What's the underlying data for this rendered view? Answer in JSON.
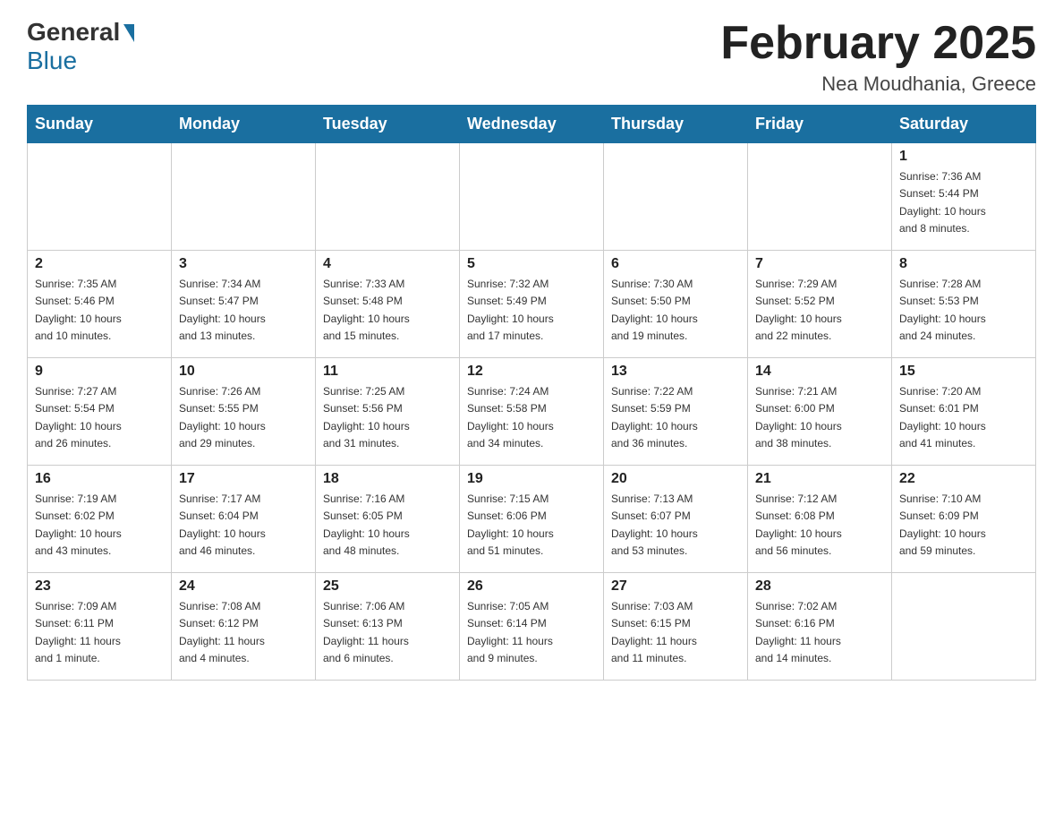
{
  "header": {
    "logo_general": "General",
    "logo_blue": "Blue",
    "month_title": "February 2025",
    "location": "Nea Moudhania, Greece"
  },
  "weekdays": [
    "Sunday",
    "Monday",
    "Tuesday",
    "Wednesday",
    "Thursday",
    "Friday",
    "Saturday"
  ],
  "weeks": [
    [
      {
        "day": "",
        "info": ""
      },
      {
        "day": "",
        "info": ""
      },
      {
        "day": "",
        "info": ""
      },
      {
        "day": "",
        "info": ""
      },
      {
        "day": "",
        "info": ""
      },
      {
        "day": "",
        "info": ""
      },
      {
        "day": "1",
        "info": "Sunrise: 7:36 AM\nSunset: 5:44 PM\nDaylight: 10 hours\nand 8 minutes."
      }
    ],
    [
      {
        "day": "2",
        "info": "Sunrise: 7:35 AM\nSunset: 5:46 PM\nDaylight: 10 hours\nand 10 minutes."
      },
      {
        "day": "3",
        "info": "Sunrise: 7:34 AM\nSunset: 5:47 PM\nDaylight: 10 hours\nand 13 minutes."
      },
      {
        "day": "4",
        "info": "Sunrise: 7:33 AM\nSunset: 5:48 PM\nDaylight: 10 hours\nand 15 minutes."
      },
      {
        "day": "5",
        "info": "Sunrise: 7:32 AM\nSunset: 5:49 PM\nDaylight: 10 hours\nand 17 minutes."
      },
      {
        "day": "6",
        "info": "Sunrise: 7:30 AM\nSunset: 5:50 PM\nDaylight: 10 hours\nand 19 minutes."
      },
      {
        "day": "7",
        "info": "Sunrise: 7:29 AM\nSunset: 5:52 PM\nDaylight: 10 hours\nand 22 minutes."
      },
      {
        "day": "8",
        "info": "Sunrise: 7:28 AM\nSunset: 5:53 PM\nDaylight: 10 hours\nand 24 minutes."
      }
    ],
    [
      {
        "day": "9",
        "info": "Sunrise: 7:27 AM\nSunset: 5:54 PM\nDaylight: 10 hours\nand 26 minutes."
      },
      {
        "day": "10",
        "info": "Sunrise: 7:26 AM\nSunset: 5:55 PM\nDaylight: 10 hours\nand 29 minutes."
      },
      {
        "day": "11",
        "info": "Sunrise: 7:25 AM\nSunset: 5:56 PM\nDaylight: 10 hours\nand 31 minutes."
      },
      {
        "day": "12",
        "info": "Sunrise: 7:24 AM\nSunset: 5:58 PM\nDaylight: 10 hours\nand 34 minutes."
      },
      {
        "day": "13",
        "info": "Sunrise: 7:22 AM\nSunset: 5:59 PM\nDaylight: 10 hours\nand 36 minutes."
      },
      {
        "day": "14",
        "info": "Sunrise: 7:21 AM\nSunset: 6:00 PM\nDaylight: 10 hours\nand 38 minutes."
      },
      {
        "day": "15",
        "info": "Sunrise: 7:20 AM\nSunset: 6:01 PM\nDaylight: 10 hours\nand 41 minutes."
      }
    ],
    [
      {
        "day": "16",
        "info": "Sunrise: 7:19 AM\nSunset: 6:02 PM\nDaylight: 10 hours\nand 43 minutes."
      },
      {
        "day": "17",
        "info": "Sunrise: 7:17 AM\nSunset: 6:04 PM\nDaylight: 10 hours\nand 46 minutes."
      },
      {
        "day": "18",
        "info": "Sunrise: 7:16 AM\nSunset: 6:05 PM\nDaylight: 10 hours\nand 48 minutes."
      },
      {
        "day": "19",
        "info": "Sunrise: 7:15 AM\nSunset: 6:06 PM\nDaylight: 10 hours\nand 51 minutes."
      },
      {
        "day": "20",
        "info": "Sunrise: 7:13 AM\nSunset: 6:07 PM\nDaylight: 10 hours\nand 53 minutes."
      },
      {
        "day": "21",
        "info": "Sunrise: 7:12 AM\nSunset: 6:08 PM\nDaylight: 10 hours\nand 56 minutes."
      },
      {
        "day": "22",
        "info": "Sunrise: 7:10 AM\nSunset: 6:09 PM\nDaylight: 10 hours\nand 59 minutes."
      }
    ],
    [
      {
        "day": "23",
        "info": "Sunrise: 7:09 AM\nSunset: 6:11 PM\nDaylight: 11 hours\nand 1 minute."
      },
      {
        "day": "24",
        "info": "Sunrise: 7:08 AM\nSunset: 6:12 PM\nDaylight: 11 hours\nand 4 minutes."
      },
      {
        "day": "25",
        "info": "Sunrise: 7:06 AM\nSunset: 6:13 PM\nDaylight: 11 hours\nand 6 minutes."
      },
      {
        "day": "26",
        "info": "Sunrise: 7:05 AM\nSunset: 6:14 PM\nDaylight: 11 hours\nand 9 minutes."
      },
      {
        "day": "27",
        "info": "Sunrise: 7:03 AM\nSunset: 6:15 PM\nDaylight: 11 hours\nand 11 minutes."
      },
      {
        "day": "28",
        "info": "Sunrise: 7:02 AM\nSunset: 6:16 PM\nDaylight: 11 hours\nand 14 minutes."
      },
      {
        "day": "",
        "info": ""
      }
    ]
  ]
}
